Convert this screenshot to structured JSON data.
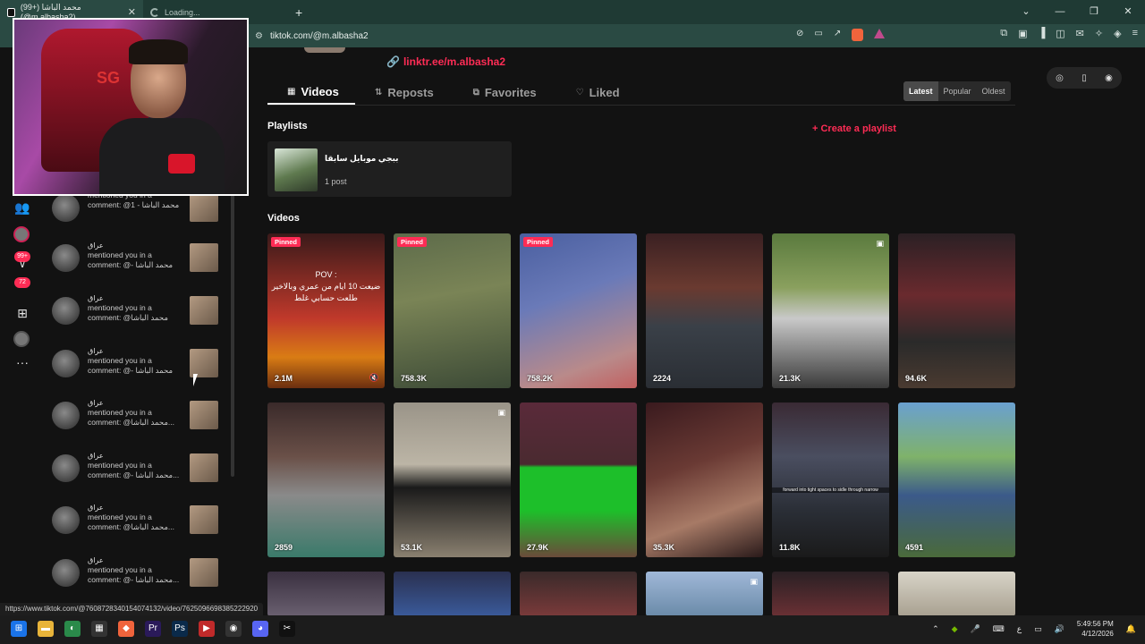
{
  "browser": {
    "tabs": [
      {
        "title": "محمد الباشا (+99) (@m.albasha2)",
        "state": "active"
      },
      {
        "title": "Loading...",
        "state": "loading"
      }
    ],
    "new_tab": "+",
    "url": "tiktok.com/@m.albasha2",
    "window_controls": [
      "⌄",
      "—",
      "❐",
      "✕"
    ]
  },
  "profile": {
    "link": "linktr.ee/m.albasha2",
    "tabs": [
      {
        "label": "Videos",
        "icon": "grid-icon",
        "active": true
      },
      {
        "label": "Reposts",
        "icon": "repost-icon"
      },
      {
        "label": "Favorites",
        "icon": "bookmark-icon"
      },
      {
        "label": "Liked",
        "icon": "heart-icon"
      }
    ],
    "sort": [
      "Latest",
      "Popular",
      "Oldest"
    ],
    "sort_selected": "Latest"
  },
  "playlists": {
    "title": "Playlists",
    "create_label": "+ Create a playlist",
    "items": [
      {
        "name": "ببجي موبايل سابقا",
        "count": "1 post"
      }
    ]
  },
  "videos": {
    "title": "Videos",
    "pov_text": "POV :\nضيعت 10 ايام من عمري وبالاخير\nطلعت حسابي غلط",
    "caption_text": "forward into tight spaces to sidle through narrow",
    "items": [
      {
        "views": "2.1M",
        "pinned": "Pinned",
        "muted": true
      },
      {
        "views": "758.3K",
        "pinned": "Pinned"
      },
      {
        "views": "758.2K",
        "pinned": "Pinned"
      },
      {
        "views": "2224"
      },
      {
        "views": "21.3K",
        "photo": true
      },
      {
        "views": "94.6K"
      },
      {
        "views": "2859"
      },
      {
        "views": "53.1K",
        "photo": true
      },
      {
        "views": "27.9K"
      },
      {
        "views": "35.3K"
      },
      {
        "views": "11.8K"
      },
      {
        "views": "4591"
      }
    ]
  },
  "notifications": {
    "items": [
      {
        "name": "",
        "text": "mentioned you in a comment: @1 - محمد الباشا"
      },
      {
        "name": "عراق",
        "text": "mentioned you in a comment: @- محمد الباشا"
      },
      {
        "name": "عراق",
        "text": "mentioned you in a comment: @محمد الباشا"
      },
      {
        "name": "عراق",
        "text": "mentioned you in a comment: @- محمد الباشا"
      },
      {
        "name": "عراق",
        "text": "mentioned you in a comment: @محمد الباشا..."
      },
      {
        "name": "عراق",
        "text": "mentioned you in a comment: @- محمد الباشا..."
      },
      {
        "name": "عراق",
        "text": "mentioned you in a comment: @محمد الباشا..."
      },
      {
        "name": "عراق",
        "text": "mentioned you in a comment: @- محمد الباشا..."
      }
    ]
  },
  "rail": {
    "badge_1": "99+",
    "badge_2": "72"
  },
  "status_url": "https://www.tiktok.com/@7608728340154074132/video/7625096698385222920",
  "taskbar": {
    "time": "5:49:56 PM",
    "date": "4/12/2026",
    "lang": "ع"
  },
  "colors": {
    "accent": "#fe2c55",
    "chrome": "#2a4a43"
  }
}
